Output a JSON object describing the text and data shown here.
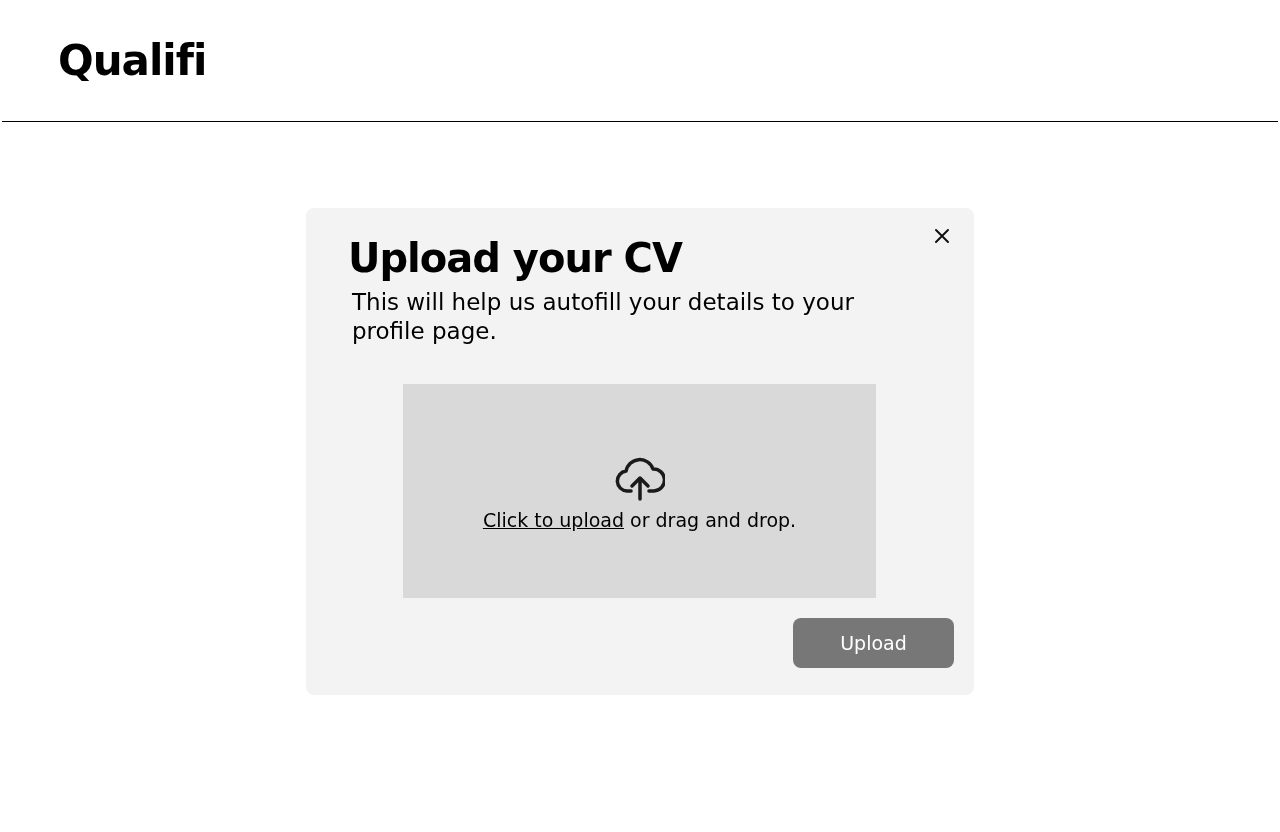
{
  "header": {
    "logo": "Qualifi"
  },
  "dialog": {
    "title": "Upload your CV",
    "description": "This will help us autofill your details to your profile page.",
    "dropzone": {
      "link": "Click to upload",
      "text": "or drag and drop."
    },
    "button": {
      "label": "Upload",
      "disabled": true
    }
  }
}
